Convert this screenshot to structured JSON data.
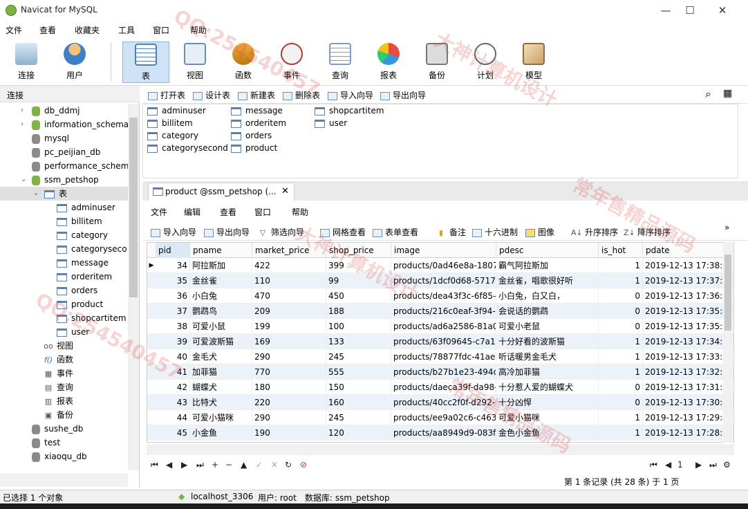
{
  "window": {
    "title": "Navicat for MySQL",
    "minimize": "—",
    "maximize": "☐",
    "close": "✕"
  },
  "menubar": [
    "文件",
    "查看",
    "收藏夹",
    "工具",
    "窗口",
    "帮助"
  ],
  "toolbar": {
    "connect": "连接",
    "user": "用户",
    "table": "表",
    "view": "视图",
    "function": "函数",
    "event": "事件",
    "query": "查询",
    "report": "报表",
    "backup": "备份",
    "schedule": "计划",
    "model": "模型"
  },
  "left_panel": {
    "header": "连接",
    "databases_top": [
      "db_ddmj",
      "information_schema",
      "mysql",
      "pc_peijian_db",
      "performance_schem",
      "ssm_petshop"
    ],
    "table_folder": "表",
    "tables": [
      "adminuser",
      "billitem",
      "category",
      "categoryseco",
      "message",
      "orderitem",
      "orders",
      "product",
      "shopcartitem",
      "user"
    ],
    "other_nodes": [
      "视图",
      "函数",
      "事件",
      "查询",
      "报表",
      "备份"
    ],
    "databases_bottom": [
      "sushe_db",
      "test",
      "xiaoqu_db"
    ]
  },
  "object_toolbar": [
    "打开表",
    "设计表",
    "新建表",
    "删除表",
    "导入向导",
    "导出向导"
  ],
  "object_list": [
    "adminuser",
    "billitem",
    "category",
    "categorysecond",
    "message",
    "orderitem",
    "orders",
    "product",
    "shopcartitem",
    "user"
  ],
  "tab": {
    "label": "product @ssm_petshop (...",
    "close": "✕"
  },
  "inner_menu": [
    "文件",
    "编辑",
    "查看",
    "窗口",
    "帮助"
  ],
  "inner_toolbar": [
    "导入向导",
    "导出向导",
    "筛选向导",
    "网格查看",
    "表单查看",
    "备注",
    "十六进制",
    "图像",
    "升序排序",
    "降序排序"
  ],
  "grid": {
    "columns": [
      "pid",
      "pname",
      "market_price",
      "shop_price",
      "image",
      "pdesc",
      "is_hot",
      "pdate"
    ],
    "rows": [
      [
        "34",
        "阿拉斯加",
        "422",
        "399",
        "products/0ad46e8a-1807",
        "霸气阿拉斯加",
        "1",
        "2019-12-13 17:38:2"
      ],
      [
        "35",
        "金丝雀",
        "110",
        "99",
        "products/1dcf0d68-5717-",
        "金丝雀，唱歌很好听",
        "1",
        "2019-12-13 17:37:1"
      ],
      [
        "36",
        "小白兔",
        "470",
        "450",
        "products/dea43f3c-6f85-",
        "小白兔，白又白，",
        "0",
        "2019-12-13 17:36:2"
      ],
      [
        "37",
        "鹦鹉鸟",
        "209",
        "188",
        "products/216c0eaf-3f94-",
        "会说话的鹦鹉",
        "0",
        "2019-12-13 17:35:4"
      ],
      [
        "38",
        "可爱小鼠",
        "199",
        "100",
        "products/ad6a2586-81a0",
        "可爱小老鼠",
        "0",
        "2019-12-13 17:35:0"
      ],
      [
        "39",
        "可爱波斯猫",
        "169",
        "133",
        "products/63f09645-c7a1-",
        "十分好看的波斯猫",
        "1",
        "2019-12-13 17:34:1"
      ],
      [
        "40",
        "金毛犬",
        "290",
        "245",
        "products/78877fdc-41ae-",
        "听话暖男金毛犬",
        "1",
        "2019-12-13 17:33:3"
      ],
      [
        "41",
        "加菲猫",
        "770",
        "555",
        "products/b27b1e23-494c",
        "高冷加菲猫",
        "1",
        "2019-12-13 17:32:2"
      ],
      [
        "42",
        "蝴蝶犬",
        "180",
        "150",
        "products/daeca39f-da98-",
        "十分惹人爱的蝴蝶犬",
        "0",
        "2019-12-13 17:31:2"
      ],
      [
        "43",
        "比特犬",
        "220",
        "160",
        "products/40cc2f0f-d292-",
        "十分凶悍",
        "0",
        "2019-12-13 17:30:4"
      ],
      [
        "44",
        "可爱小猫咪",
        "290",
        "245",
        "products/ee9a02c6-c463-",
        "可爱小猫咪",
        "1",
        "2019-12-13 17:29:4"
      ],
      [
        "45",
        "小金鱼",
        "190",
        "120",
        "products/aa8949d9-083f-",
        "金色小金鱼",
        "1",
        "2019-12-13 17:28:3"
      ]
    ]
  },
  "navigator": {
    "page": "1"
  },
  "record_info": "第 1 条记录 (共 28 条) 于 1 页",
  "status": {
    "selection": "已选择 1 个对象",
    "connection": "localhost_3306",
    "user": "用户: root",
    "database": "数据库: ssm_petshop"
  },
  "watermarks": [
    "QQ:254540457",
    "大神计算机设计",
    "常年售精品源码",
    "QQ:254540457",
    "大神计算机设计",
    "常年售精品源码"
  ],
  "colors": {
    "active_toolbar": "#cfe3f7",
    "alt_row": "#ecf2fa",
    "watermark": "#dc3c3c"
  }
}
